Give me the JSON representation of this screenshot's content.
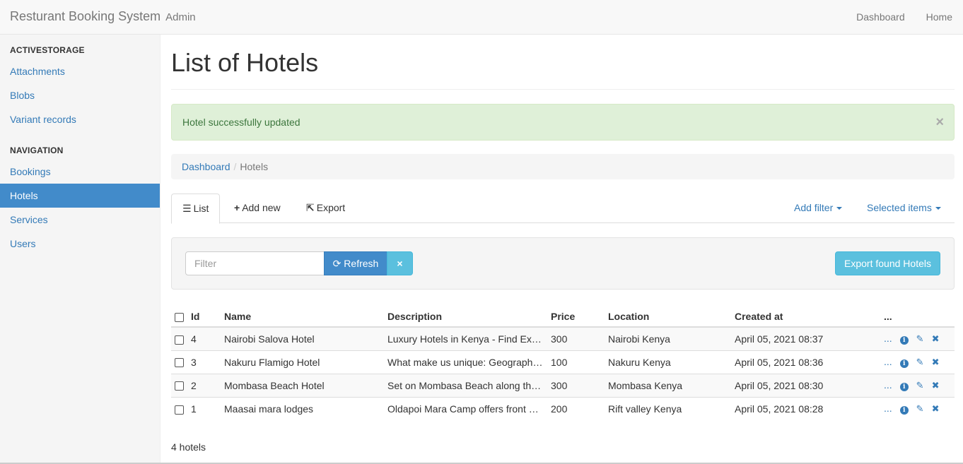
{
  "navbar": {
    "brand": "Resturant Booking System",
    "brand_sub": "Admin",
    "links": [
      "Dashboard",
      "Home"
    ]
  },
  "sidebar": {
    "sections": [
      {
        "header": "ACTIVESTORAGE",
        "items": [
          "Attachments",
          "Blobs",
          "Variant records"
        ]
      },
      {
        "header": "NAVIGATION",
        "items": [
          "Bookings",
          "Hotels",
          "Services",
          "Users"
        ]
      }
    ],
    "active_item": "Hotels"
  },
  "main": {
    "title": "List of Hotels",
    "alert": {
      "text": "Hotel successfully updated",
      "close": "×"
    },
    "breadcrumb": {
      "link": "Dashboard",
      "sep": "/",
      "current": "Hotels"
    },
    "tabs": {
      "list": "List",
      "add_new": "Add new",
      "export": "Export",
      "add_filter": "Add filter",
      "selected_items": "Selected items"
    },
    "filter": {
      "placeholder": "Filter",
      "refresh": "Refresh",
      "clear_icon": "×",
      "export_found": "Export found Hotels"
    },
    "table": {
      "headers": [
        "Id",
        "Name",
        "Description",
        "Price",
        "Location",
        "Created at",
        "..."
      ],
      "rows": [
        {
          "id": "4",
          "name": "Nairobi Salova Hotel",
          "description": "Luxury Hotels in Kenya - Find Ex…",
          "price": "300",
          "location": "Nairobi Kenya",
          "created": "April 05, 2021 08:37"
        },
        {
          "id": "3",
          "name": "Nakuru Flamigo Hotel",
          "description": "What make us unique: Geograph…",
          "price": "100",
          "location": "Nakuru Kenya",
          "created": "April 05, 2021 08:36"
        },
        {
          "id": "2",
          "name": "Mombasa Beach Hotel",
          "description": "Set on Mombasa Beach along th…",
          "price": "300",
          "location": "Mombasa Kenya",
          "created": "April 05, 2021 08:30"
        },
        {
          "id": "1",
          "name": "Maasai mara lodges",
          "description": "Oldapoi Mara Camp offers front s…",
          "price": "200",
          "location": "Rift valley Kenya",
          "created": "April 05, 2021 08:28"
        }
      ],
      "row_dots": "...",
      "icons": [
        "info-icon",
        "pencil-icon",
        "delete-icon"
      ]
    },
    "count": "4 hotels"
  },
  "colors": {
    "primary": "#337ab7",
    "active_bg": "#428bca",
    "info": "#5bc0de",
    "success_bg": "#dff0d8"
  }
}
